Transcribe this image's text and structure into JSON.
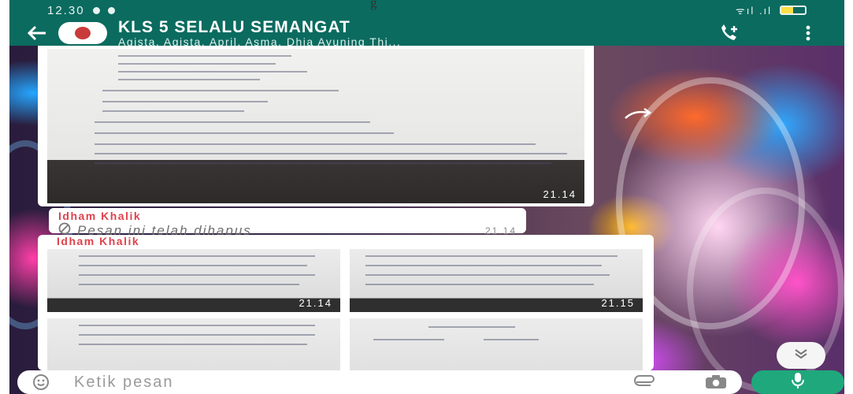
{
  "page": {
    "caption": "g"
  },
  "status_bar": {
    "time": "12.30",
    "signal_text": "ᯤıl .ıl",
    "battery_level": 0.5
  },
  "header": {
    "title": "KLS 5 SELALU SEMANGAT",
    "members": "Agista, Agista, April, Asma, Dhia Ayuning Thi..."
  },
  "messages": [
    {
      "type": "image",
      "time": "21.14"
    },
    {
      "type": "deleted",
      "sender": "Idham Khalik",
      "text": "Pesan ini telah dihapus",
      "time": "21.14"
    },
    {
      "type": "image_group",
      "sender": "Idham Khalik",
      "times": [
        "21.14",
        "21.15"
      ]
    }
  ],
  "composer": {
    "placeholder": "Ketik pesan"
  },
  "colors": {
    "header": "#0b6b5f",
    "sender": "#e0424c",
    "mic": "#1fa87c"
  },
  "icons": [
    "back-arrow-icon",
    "add-call-icon",
    "more-vert-icon",
    "blocked-icon",
    "emoji-icon",
    "attach-icon",
    "camera-icon",
    "mic-icon",
    "scroll-down-icon"
  ]
}
